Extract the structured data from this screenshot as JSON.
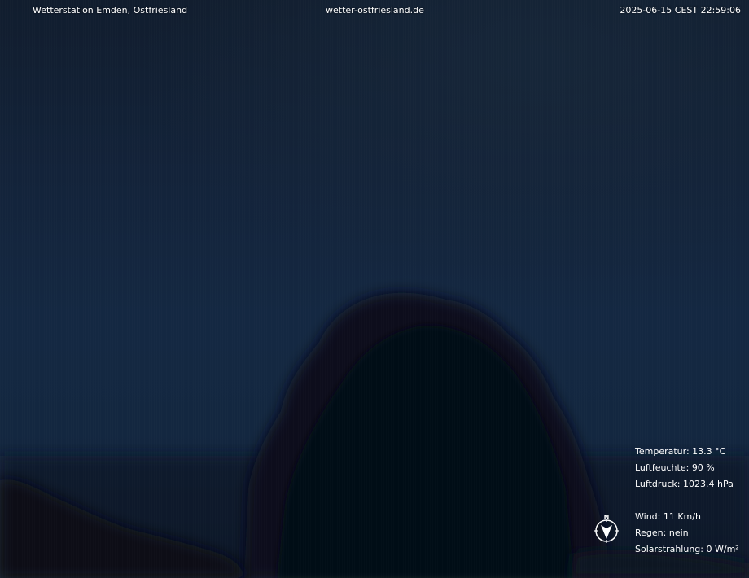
{
  "overlay": {
    "station_name": "Wetterstation Emden, Ostfriesland",
    "website": "wetter-ostfriesland.de",
    "timestamp": "2025-06-15 CEST 22:59:06"
  },
  "weather": {
    "temperature": "Temperatur: 13.3 °C",
    "humidity": "Luftfeuchte: 90 %",
    "pressure": "Luftdruck: 1023.4 hPa",
    "wind": "Wind: 11 Km/h",
    "rain": "Regen: nein",
    "solar": "Solarstrahlung: 0 W/m²"
  },
  "compass": {
    "north_label": "N",
    "icon": "compass-wind-direction-icon"
  },
  "colors": {
    "sky_top": "#111d2e",
    "sky_mid": "#142842",
    "tree_silhouette": "#070d16",
    "overlay_text": "#ffffff"
  }
}
